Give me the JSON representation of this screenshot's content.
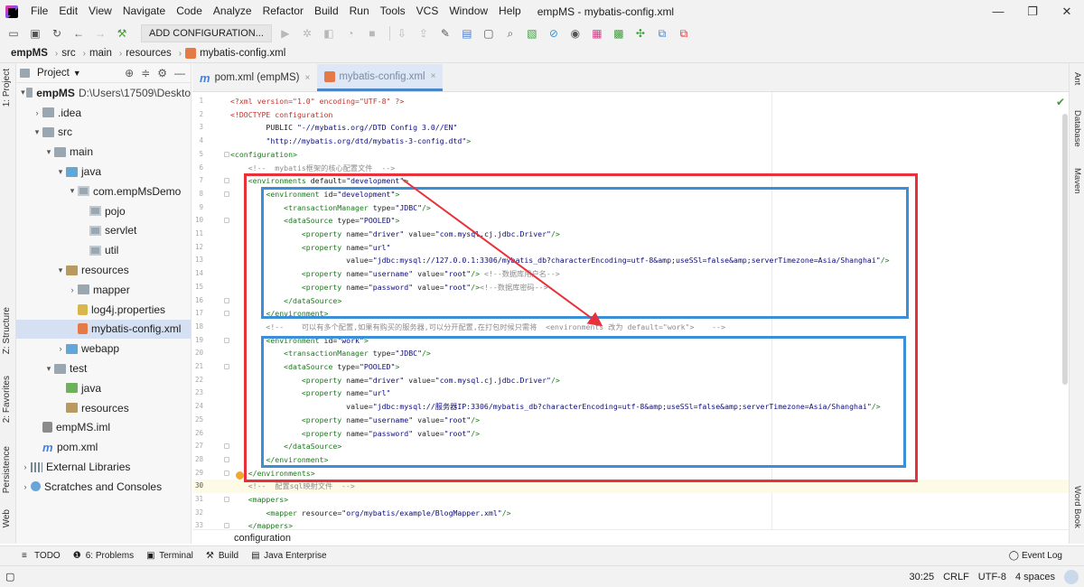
{
  "window": {
    "title": "empMS - mybatis-config.xml",
    "menu": [
      "File",
      "Edit",
      "View",
      "Navigate",
      "Code",
      "Analyze",
      "Refactor",
      "Build",
      "Run",
      "Tools",
      "VCS",
      "Window",
      "Help"
    ],
    "controls": {
      "minimize": "—",
      "maximize": "❐",
      "close": "✕"
    }
  },
  "toolbar": {
    "add_configuration": "ADD CONFIGURATION..."
  },
  "breadcrumb": [
    "empMS",
    "src",
    "main",
    "resources",
    "mybatis-config.xml"
  ],
  "left_strip": {
    "project_tab": "1: Project",
    "structure_tab": "Z: Structure",
    "favorites_tab": "2: Favorites",
    "persistence_tab": "Persistence",
    "web_tab": "Web"
  },
  "project_panel": {
    "title": "Project",
    "tree": [
      {
        "label": "empMS",
        "extra": "D:\\Users\\17509\\Deskto",
        "bold": true
      },
      {
        "label": ".idea"
      },
      {
        "label": "src"
      },
      {
        "label": "main"
      },
      {
        "label": "java"
      },
      {
        "label": "com.empMsDemo"
      },
      {
        "label": "pojo"
      },
      {
        "label": "servlet"
      },
      {
        "label": "util"
      },
      {
        "label": "resources"
      },
      {
        "label": "mapper"
      },
      {
        "label": "log4j.properties"
      },
      {
        "label": "mybatis-config.xml"
      },
      {
        "label": "webapp"
      },
      {
        "label": "test"
      },
      {
        "label": "java"
      },
      {
        "label": "resources"
      },
      {
        "label": "empMS.iml"
      },
      {
        "label": "pom.xml"
      },
      {
        "label": "External Libraries"
      },
      {
        "label": "Scratches and Consoles"
      }
    ]
  },
  "editor_tabs": [
    {
      "label": "pom.xml (empMS)",
      "close": "×"
    },
    {
      "label": "mybatis-config.xml",
      "close": "×"
    }
  ],
  "code_lines": [
    {
      "n": "1",
      "text": "<?xml version=\"1.0\" encoding=\"UTF-8\" ?>"
    },
    {
      "n": "2",
      "text": "<!DOCTYPE configuration"
    },
    {
      "n": "3",
      "text": "        PUBLIC \"-//mybatis.org//DTD Config 3.0//EN\""
    },
    {
      "n": "4",
      "text": "        \"http://mybatis.org/dtd/mybatis-3-config.dtd\">"
    },
    {
      "n": "5",
      "text": "<configuration>"
    },
    {
      "n": "6",
      "text": "    <!--  mybatis框架的核心配置文件  -->"
    },
    {
      "n": "7",
      "text": "    <environments default=\"development\">"
    },
    {
      "n": "8",
      "text": "        <environment id=\"development\">"
    },
    {
      "n": "9",
      "text": "            <transactionManager type=\"JDBC\"/>"
    },
    {
      "n": "10",
      "text": "            <dataSource type=\"POOLED\">"
    },
    {
      "n": "11",
      "text": "                <property name=\"driver\" value=\"com.mysql.cj.jdbc.Driver\"/>"
    },
    {
      "n": "12",
      "text": "                <property name=\"url\""
    },
    {
      "n": "13",
      "text": "                          value=\"jdbc:mysql://127.0.0.1:3306/mybatis_db?characterEncoding=utf-8&amp;useSSl=false&amp;serverTimezone=Asia/Shanghai\"/>"
    },
    {
      "n": "14",
      "text": "                <property name=\"username\" value=\"root\"/> <!--数据库用户名-->"
    },
    {
      "n": "15",
      "text": "                <property name=\"password\" value=\"root\"/><!--数据库密码-->"
    },
    {
      "n": "16",
      "text": "            </dataSource>"
    },
    {
      "n": "17",
      "text": "        </environment>"
    },
    {
      "n": "18",
      "text": "        <!--    可以有多个配置,如果有购买的服务器,可以分开配置,在打包时候只需将  <environments 改为 default=\"work\">    -->"
    },
    {
      "n": "19",
      "text": "        <environment id=\"work\">"
    },
    {
      "n": "20",
      "text": "            <transactionManager type=\"JDBC\"/>"
    },
    {
      "n": "21",
      "text": "            <dataSource type=\"POOLED\">"
    },
    {
      "n": "22",
      "text": "                <property name=\"driver\" value=\"com.mysql.cj.jdbc.Driver\"/>"
    },
    {
      "n": "23",
      "text": "                <property name=\"url\""
    },
    {
      "n": "24",
      "text": "                          value=\"jdbc:mysql://服务器IP:3306/mybatis_db?characterEncoding=utf-8&amp;useSSl=false&amp;serverTimezone=Asia/Shanghai\"/>"
    },
    {
      "n": "25",
      "text": "                <property name=\"username\" value=\"root\"/>"
    },
    {
      "n": "26",
      "text": "                <property name=\"password\" value=\"root\"/>"
    },
    {
      "n": "27",
      "text": "            </dataSource>"
    },
    {
      "n": "28",
      "text": "        </environment>"
    },
    {
      "n": "29",
      "text": "    </environments>"
    },
    {
      "n": "30",
      "text": "    <!--  配置sql映射文件  -->"
    },
    {
      "n": "31",
      "text": "    <mappers>"
    },
    {
      "n": "32",
      "text": "        <mapper resource=\"org/mybatis/example/BlogMapper.xml\"/>"
    },
    {
      "n": "33",
      "text": "    </mappers>"
    }
  ],
  "current_line": "30",
  "editor_breadcrumb": "configuration",
  "right_strip": {
    "ant": "Ant",
    "database": "Database",
    "maven": "Maven",
    "word_book": "Word Book"
  },
  "bottom_tools": [
    {
      "label": "TODO"
    },
    {
      "label": "6: Problems"
    },
    {
      "label": "Terminal"
    },
    {
      "label": "Build"
    },
    {
      "label": "Java Enterprise"
    }
  ],
  "event_log": "Event Log",
  "status": {
    "position": "30:25",
    "line_sep": "CRLF",
    "encoding": "UTF-8",
    "indent": "4 spaces"
  },
  "colors": {
    "red_box": "#e8313a",
    "blue_box": "#3a8fd8",
    "selection": "#d5e1f2"
  }
}
